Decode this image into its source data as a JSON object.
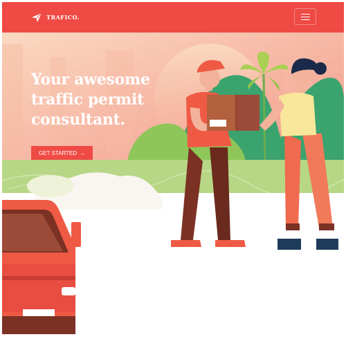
{
  "brand": {
    "name": "TRAFICO.",
    "icon": "paper-plane-icon"
  },
  "nav": {
    "menu_icon": "hamburger-menu-icon"
  },
  "hero": {
    "title": "Your awesome\ntraffic permit\nconsultant.",
    "cta_label": "GET STARTED",
    "cta_icon": "arrow-right-icon"
  },
  "colors": {
    "accent": "#ef4a44",
    "sky_top": "#f8d2b7",
    "sky_bottom": "#f2a08c",
    "grass": "#b7d786",
    "tree": "#3ba36e",
    "shirt": "#ef5a45",
    "pants": "#7b3124",
    "box": "#9b4b38"
  }
}
